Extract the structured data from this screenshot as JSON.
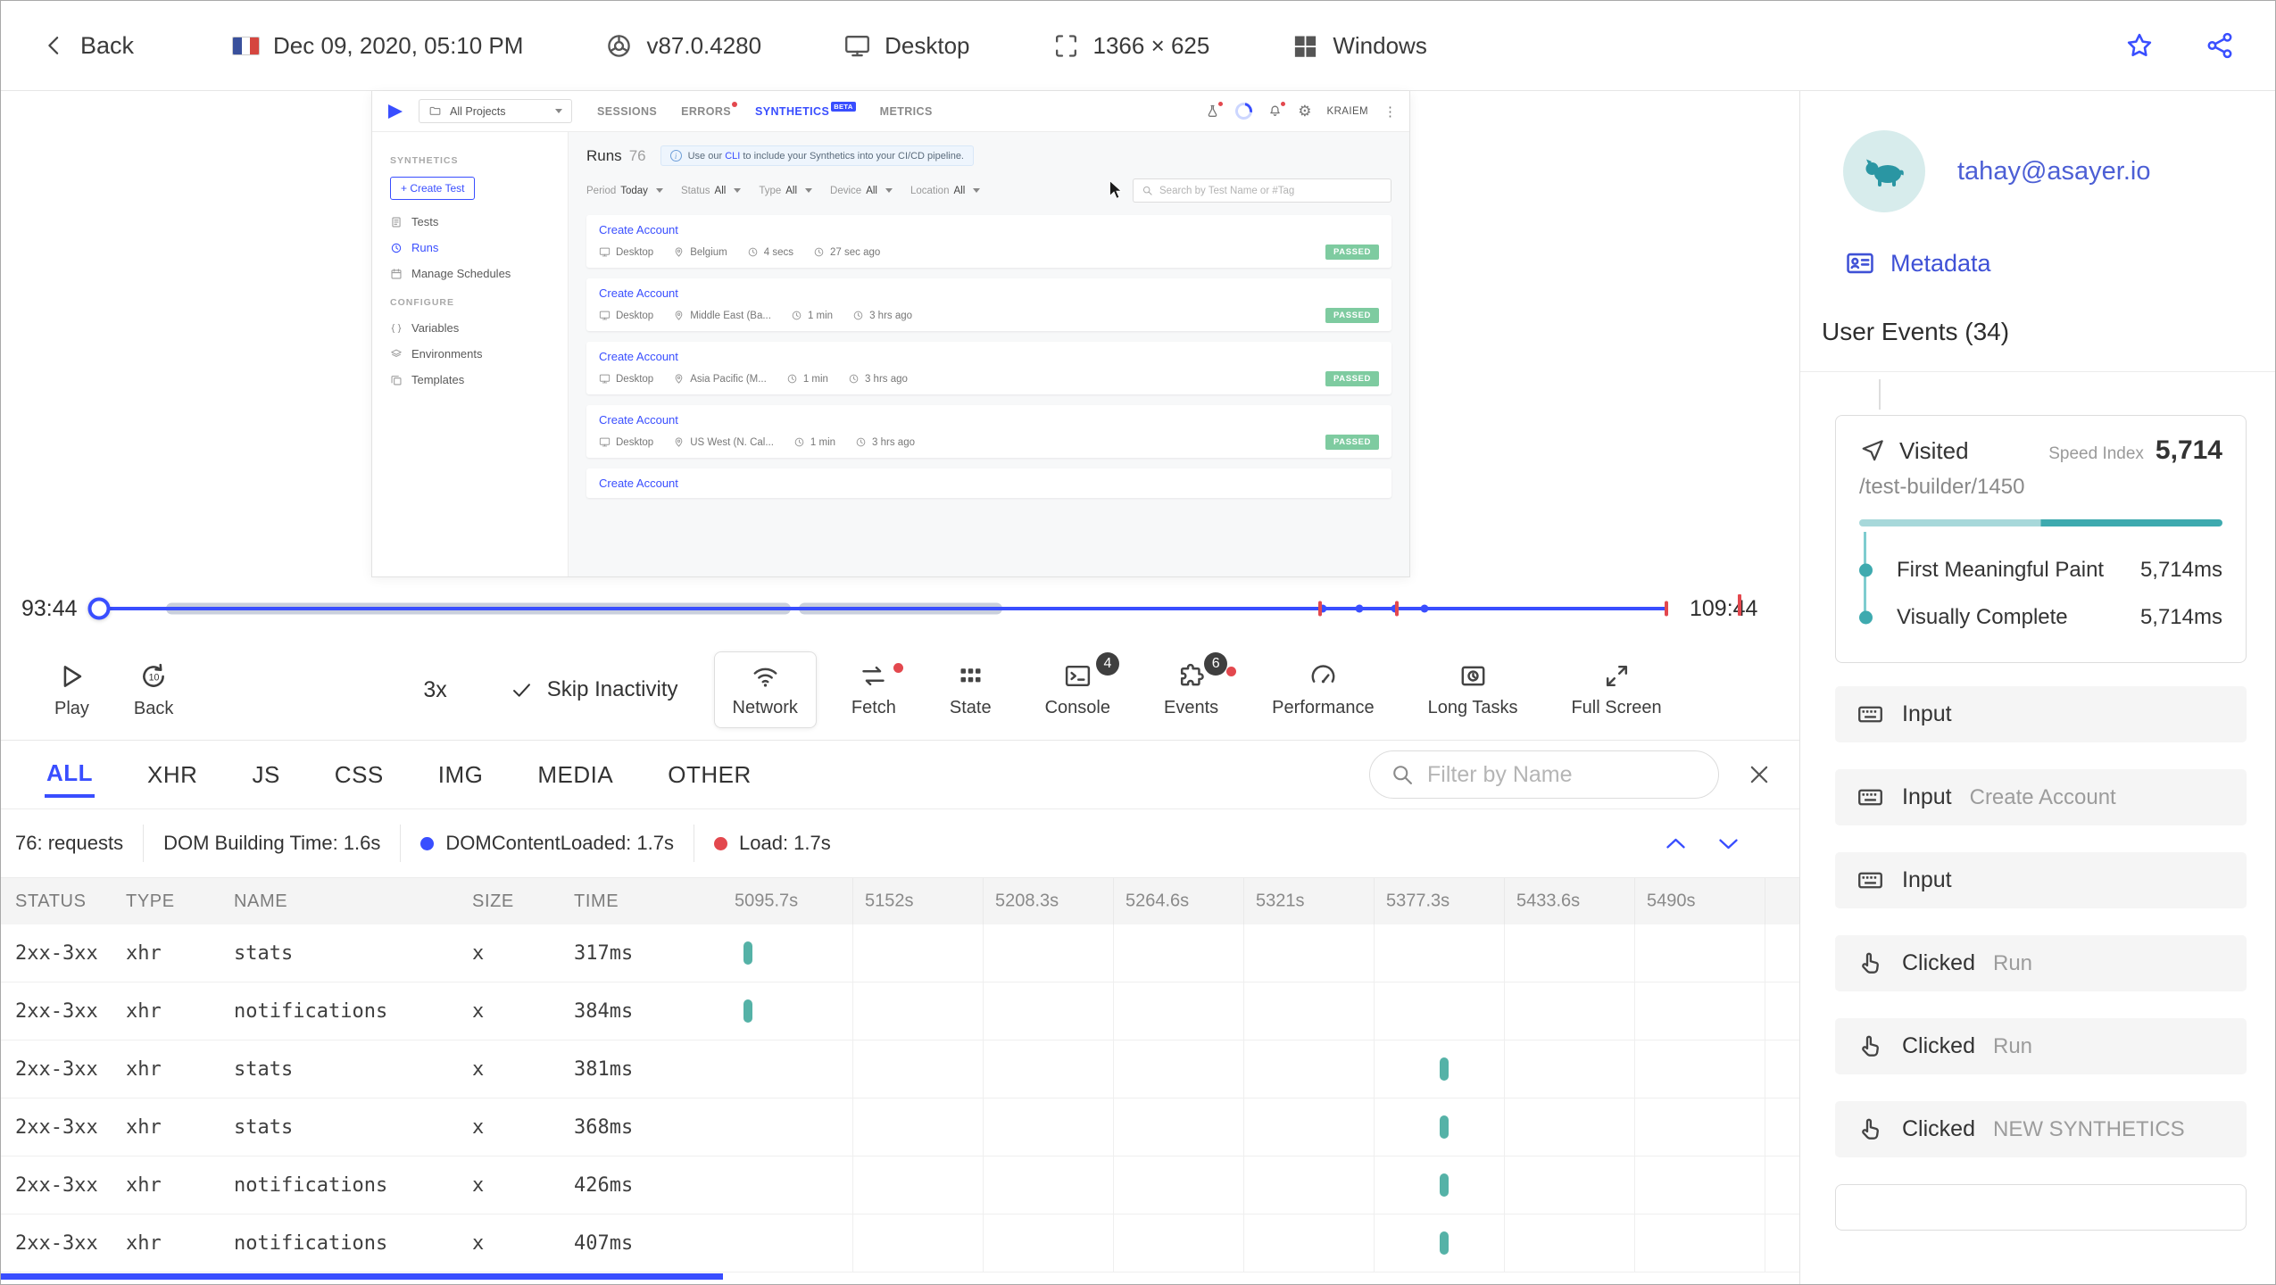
{
  "colors": {
    "accent": "#394eff",
    "teal": "#3eaaaf",
    "red": "#e3484e",
    "green": "#7ecba0"
  },
  "topbar": {
    "back_label": "Back",
    "datetime": "Dec 09, 2020, 05:10 PM",
    "browser_version": "v87.0.4280",
    "device": "Desktop",
    "resolution": "1366 × 625",
    "os": "Windows"
  },
  "replay_app": {
    "nav": {
      "project": "All Projects",
      "tabs": [
        "SESSIONS",
        "ERRORS",
        "SYNTHETICS",
        "METRICS"
      ],
      "synthetics_badge": "BETA",
      "user": "KRAIEM"
    },
    "sidebar": {
      "section_synthetics": "SYNTHETICS",
      "create_test": "+ Create Test",
      "tests": "Tests",
      "runs": "Runs",
      "manage_schedules": "Manage Schedules",
      "section_configure": "CONFIGURE",
      "variables": "Variables",
      "environments": "Environments",
      "templates": "Templates"
    },
    "main": {
      "title": "Runs",
      "count": "76",
      "banner_prefix": "Use our ",
      "banner_link": "CLI",
      "banner_suffix": " to include your Synthetics into your CI/CD pipeline.",
      "filters": [
        {
          "label": "Period",
          "value": "Today"
        },
        {
          "label": "Status",
          "value": "All"
        },
        {
          "label": "Type",
          "value": "All"
        },
        {
          "label": "Device",
          "value": "All"
        },
        {
          "label": "Location",
          "value": "All"
        }
      ],
      "search_placeholder": "Search by Test Name or #Tag",
      "runs": [
        {
          "name": "Create Account",
          "device": "Desktop",
          "location": "Belgium",
          "duration": "4 secs",
          "ago": "27 sec ago",
          "status": "PASSED"
        },
        {
          "name": "Create Account",
          "device": "Desktop",
          "location": "Middle East (Ba...",
          "duration": "1 min",
          "ago": "3 hrs ago",
          "status": "PASSED"
        },
        {
          "name": "Create Account",
          "device": "Desktop",
          "location": "Asia Pacific (M...",
          "duration": "1 min",
          "ago": "3 hrs ago",
          "status": "PASSED"
        },
        {
          "name": "Create Account",
          "device": "Desktop",
          "location": "US West (N. Cal...",
          "duration": "1 min",
          "ago": "3 hrs ago",
          "status": "PASSED"
        },
        {
          "name": "Create Account",
          "device": "",
          "location": "",
          "duration": "",
          "ago": "",
          "status": ""
        }
      ]
    }
  },
  "timeline": {
    "current": "93:44",
    "total": "109:44"
  },
  "controls": {
    "play": "Play",
    "back": "Back",
    "speed": "3x",
    "skip": "Skip Inactivity",
    "panels": [
      {
        "label": "Network"
      },
      {
        "label": "Fetch"
      },
      {
        "label": "State"
      },
      {
        "label": "Console",
        "badge": "4"
      },
      {
        "label": "Events",
        "badge": "6"
      },
      {
        "label": "Performance"
      },
      {
        "label": "Long Tasks"
      },
      {
        "label": "Full Screen"
      }
    ]
  },
  "network_panel": {
    "tabs": [
      "ALL",
      "XHR",
      "JS",
      "CSS",
      "IMG",
      "MEDIA",
      "OTHER"
    ],
    "filter_placeholder": "Filter by Name",
    "summary": {
      "requests": "76: requests",
      "dom_building": "DOM Building Time: 1.6s",
      "dom_content_loaded": "DOMContentLoaded: 1.7s",
      "load": "Load: 1.7s"
    },
    "table": {
      "headers": [
        "STATUS",
        "TYPE",
        "NAME",
        "SIZE",
        "TIME"
      ],
      "time_headers": [
        "5095.7s",
        "5152s",
        "5208.3s",
        "5264.6s",
        "5321s",
        "5377.3s",
        "5433.6s",
        "5490s"
      ],
      "rows": [
        {
          "status": "2xx-3xx",
          "type": "xhr",
          "name": "stats",
          "size": "x",
          "time": "317ms",
          "tick_x": 23
        },
        {
          "status": "2xx-3xx",
          "type": "xhr",
          "name": "notifications",
          "size": "x",
          "time": "384ms",
          "tick_x": 23
        },
        {
          "status": "2xx-3xx",
          "type": "xhr",
          "name": "stats",
          "size": "x",
          "time": "381ms",
          "tick_x": 803
        },
        {
          "status": "2xx-3xx",
          "type": "xhr",
          "name": "stats",
          "size": "x",
          "time": "368ms",
          "tick_x": 803
        },
        {
          "status": "2xx-3xx",
          "type": "xhr",
          "name": "notifications",
          "size": "x",
          "time": "426ms",
          "tick_x": 803
        },
        {
          "status": "2xx-3xx",
          "type": "xhr",
          "name": "notifications",
          "size": "x",
          "time": "407ms",
          "tick_x": 803
        }
      ]
    }
  },
  "user_panel": {
    "email": "tahay@asayer.io",
    "metadata_label": "Metadata",
    "events_title": "User Events (34)",
    "visited_card": {
      "label": "Visited",
      "speed_index_label": "Speed Index",
      "speed_index_value": "5,714",
      "path": "/test-builder/1450",
      "metrics": [
        {
          "label": "First Meaningful Paint",
          "value": "5,714ms"
        },
        {
          "label": "Visually Complete",
          "value": "5,714ms"
        }
      ]
    },
    "events": [
      {
        "type": "input",
        "label": "Input",
        "detail": ""
      },
      {
        "type": "input",
        "label": "Input",
        "detail": "Create Account"
      },
      {
        "type": "input",
        "label": "Input",
        "detail": ""
      },
      {
        "type": "click",
        "label": "Clicked",
        "detail": "Run"
      },
      {
        "type": "click",
        "label": "Clicked",
        "detail": "Run"
      },
      {
        "type": "click",
        "label": "Clicked",
        "detail": "NEW SYNTHETICS"
      }
    ]
  }
}
